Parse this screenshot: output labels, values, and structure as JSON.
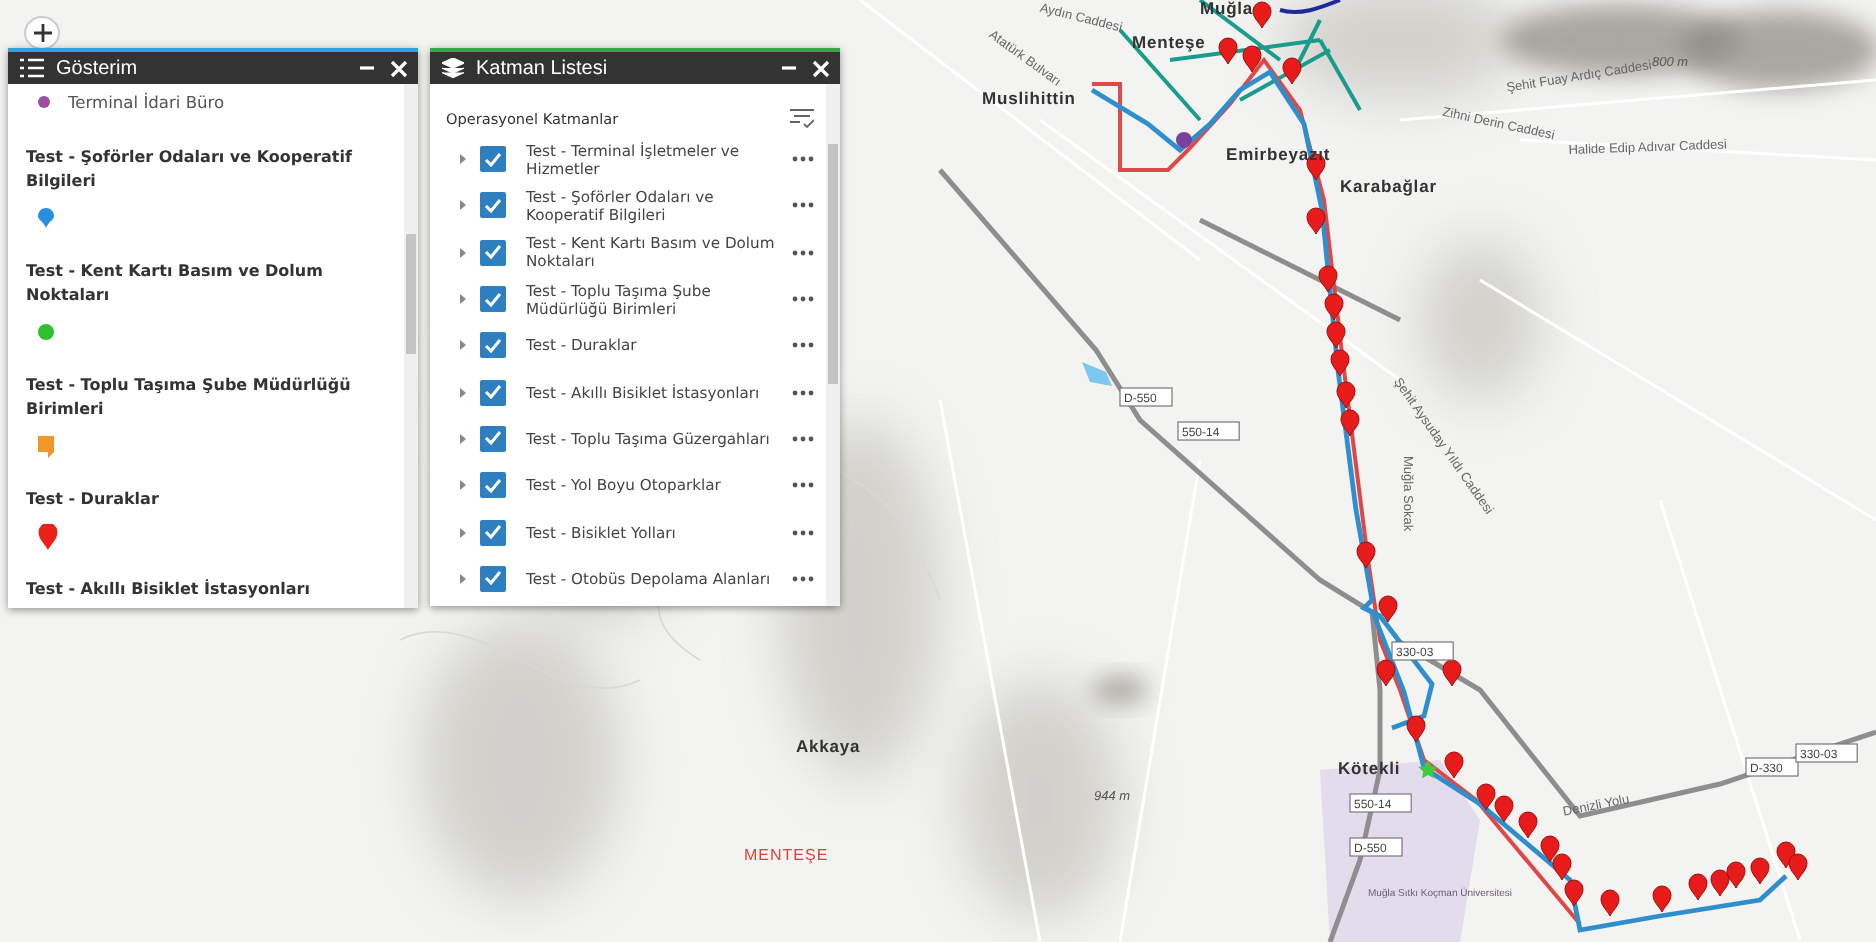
{
  "map": {
    "labels": [
      {
        "kind": "place",
        "text": "Muğla"
      },
      {
        "kind": "place",
        "text": "Menteşe"
      },
      {
        "kind": "place",
        "text": "Muslihittin"
      },
      {
        "kind": "place",
        "text": "Emirbeyazıt"
      },
      {
        "kind": "place",
        "text": "Karabağlar"
      },
      {
        "kind": "street",
        "text": "Atatürk Bulvarı"
      },
      {
        "kind": "street",
        "text": "Aydın Caddesi"
      },
      {
        "kind": "street",
        "text": "Zihni Derin Caddesi"
      },
      {
        "kind": "street",
        "text": "Şehit Fuay Ardıç Caddesi"
      },
      {
        "kind": "street",
        "text": "Halide Edip Adıvar Caddesi"
      },
      {
        "kind": "street",
        "text": "Şehit Aysuday Yıldı Caddesi"
      },
      {
        "kind": "street",
        "text": "Muğla Sokak"
      },
      {
        "kind": "street",
        "text": "Denizli Yolu"
      },
      {
        "kind": "shield",
        "text": "D-550"
      },
      {
        "kind": "shield",
        "text": "550-14"
      },
      {
        "kind": "shield",
        "text": "330-03"
      },
      {
        "kind": "shield",
        "text": "D-330"
      },
      {
        "kind": "shield",
        "text": "330-03"
      },
      {
        "kind": "shield",
        "text": "550-14"
      },
      {
        "kind": "shield",
        "text": "D-550"
      },
      {
        "kind": "place",
        "text": "Akkaya"
      },
      {
        "kind": "place",
        "text": "Kötekli"
      },
      {
        "kind": "elevation",
        "text": "944 m"
      },
      {
        "kind": "elevation",
        "text": "800 m"
      },
      {
        "kind": "district",
        "text": "MENTEŞE"
      },
      {
        "kind": "campus",
        "text": "Muğla Sıtkı Koçman Üniversitesi"
      }
    ]
  },
  "legend": {
    "title": "Gösterim",
    "items": [
      {
        "kind": "entry",
        "label": "Terminal İdari Büro",
        "color": "#9b4f9e"
      },
      {
        "kind": "heading",
        "label": "Test - Şoförler Odaları ve Kooperatif Bilgileri"
      },
      {
        "kind": "drop",
        "color": "#2a8ee0"
      },
      {
        "kind": "heading",
        "label": "Test - Kent Kartı Basım ve Dolum Noktaları"
      },
      {
        "kind": "circle",
        "color": "#2fbf2f"
      },
      {
        "kind": "heading",
        "label": "Test - Toplu Taşıma Şube Müdürlüğü Birimleri"
      },
      {
        "kind": "tag",
        "color": "#f0962a"
      },
      {
        "kind": "heading",
        "label": "Test - Duraklar"
      },
      {
        "kind": "pin",
        "color": "#e8211d"
      },
      {
        "kind": "heading",
        "label": "Test - Akıllı Bisiklet İstasyonları"
      }
    ]
  },
  "layer_list": {
    "title": "Katman Listesi",
    "section": "Operasyonel Katmanlar",
    "layers": [
      {
        "label": "Test - Terminal İşletmeler ve Hizmetler",
        "checked": true,
        "expanded": false
      },
      {
        "label": "Test - Şoförler Odaları ve Kooperatif Bilgileri",
        "checked": true,
        "expanded": false
      },
      {
        "label": "Test - Kent Kartı Basım ve Dolum Noktaları",
        "checked": true,
        "expanded": false
      },
      {
        "label": "Test - Toplu Taşıma Şube Müdürlüğü Birimleri",
        "checked": true,
        "expanded": false
      },
      {
        "label": "Test - Duraklar",
        "checked": true,
        "expanded": false
      },
      {
        "label": "Test - Akıllı Bisiklet İstasyonları",
        "checked": true,
        "expanded": false
      },
      {
        "label": "Test - Toplu Taşıma Güzergahları",
        "checked": true,
        "expanded": false
      },
      {
        "label": "Test - Yol Boyu Otoparklar",
        "checked": true,
        "expanded": false
      },
      {
        "label": "Test - Bisiklet Yolları",
        "checked": true,
        "expanded": false
      },
      {
        "label": "Test - Otobüs Depolama Alanları",
        "checked": true,
        "expanded": false
      }
    ]
  }
}
